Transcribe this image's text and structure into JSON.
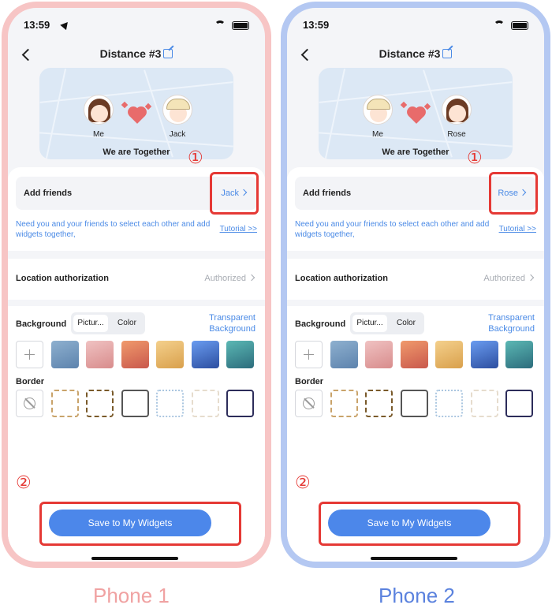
{
  "colors": {
    "accent_blue": "#4a8ae6",
    "highlight_red": "#e53935",
    "phone1_frame": "#f7c5c5",
    "phone2_frame": "#b4c8f2",
    "caption1": "#f0a2a2",
    "caption2": "#5b82de",
    "button_blue": "#4c87ea"
  },
  "phones": [
    {
      "status_time": "13:59",
      "title": "Distance #3",
      "left_name": "Me",
      "right_name": "Jack",
      "left_avatar": "girl",
      "right_avatar": "boy",
      "together_text": "We are Together",
      "add_friends_label": "Add friends",
      "add_friends_value": "Jack",
      "hint_text": "Need you and your friends to select each other and add widgets together,",
      "tutorial_link": "Tutorial >>",
      "location_label": "Location authorization",
      "location_value": "Authorized",
      "background_label": "Background",
      "seg_picture": "Pictur...",
      "seg_color": "Color",
      "transparent_label": "Transparent Background",
      "border_label": "Border",
      "save_button": "Save to My Widgets",
      "step1": "①",
      "step2": "②",
      "caption": "Phone 1"
    },
    {
      "status_time": "13:59",
      "title": "Distance #3",
      "left_name": "Me",
      "right_name": "Rose",
      "left_avatar": "boy",
      "right_avatar": "girl",
      "together_text": "We are Together",
      "add_friends_label": "Add friends",
      "add_friends_value": "Rose",
      "hint_text": "Need you and your friends to select each other and add widgets together,",
      "tutorial_link": "Tutorial >>",
      "location_label": "Location authorization",
      "location_value": "Authorized",
      "background_label": "Background",
      "seg_picture": "Pictur...",
      "seg_color": "Color",
      "transparent_label": "Transparent Background",
      "border_label": "Border",
      "save_button": "Save to My Widgets",
      "step1": "①",
      "step2": "②",
      "caption": "Phone 2"
    }
  ],
  "background_swatches": [
    {
      "name": "blue-gray-swatch",
      "gradient": "linear-gradient(160deg,#8eb0cf,#5d83ad)"
    },
    {
      "name": "pink-glitter-swatch",
      "gradient": "linear-gradient(160deg,#f0c2c2,#d88c8c)"
    },
    {
      "name": "coral-swatch",
      "gradient": "linear-gradient(160deg,#f09a6c,#c9584c)"
    },
    {
      "name": "gold-swatch",
      "gradient": "linear-gradient(160deg,#f4d08c,#d9a04c)"
    },
    {
      "name": "royal-blue-swatch",
      "gradient": "linear-gradient(160deg,#6a9cf0,#2c4ea0)"
    },
    {
      "name": "teal-swatch",
      "gradient": "linear-gradient(160deg,#5bb8b4,#2c6c7c)"
    }
  ],
  "border_swatches": [
    {
      "name": "gold-dashed-border",
      "style": "2px dashed #c9a36a"
    },
    {
      "name": "black-gold-dashed-border",
      "style": "2px dashed #7a5a2a"
    },
    {
      "name": "black-corner-border",
      "style": "2px solid #555"
    },
    {
      "name": "light-blue-pattern-border",
      "style": "2px dotted #aac6e0"
    },
    {
      "name": "white-wavy-border",
      "style": "2px dashed #e6dccd"
    },
    {
      "name": "navy-border",
      "style": "2px solid #2c2c5a"
    }
  ]
}
